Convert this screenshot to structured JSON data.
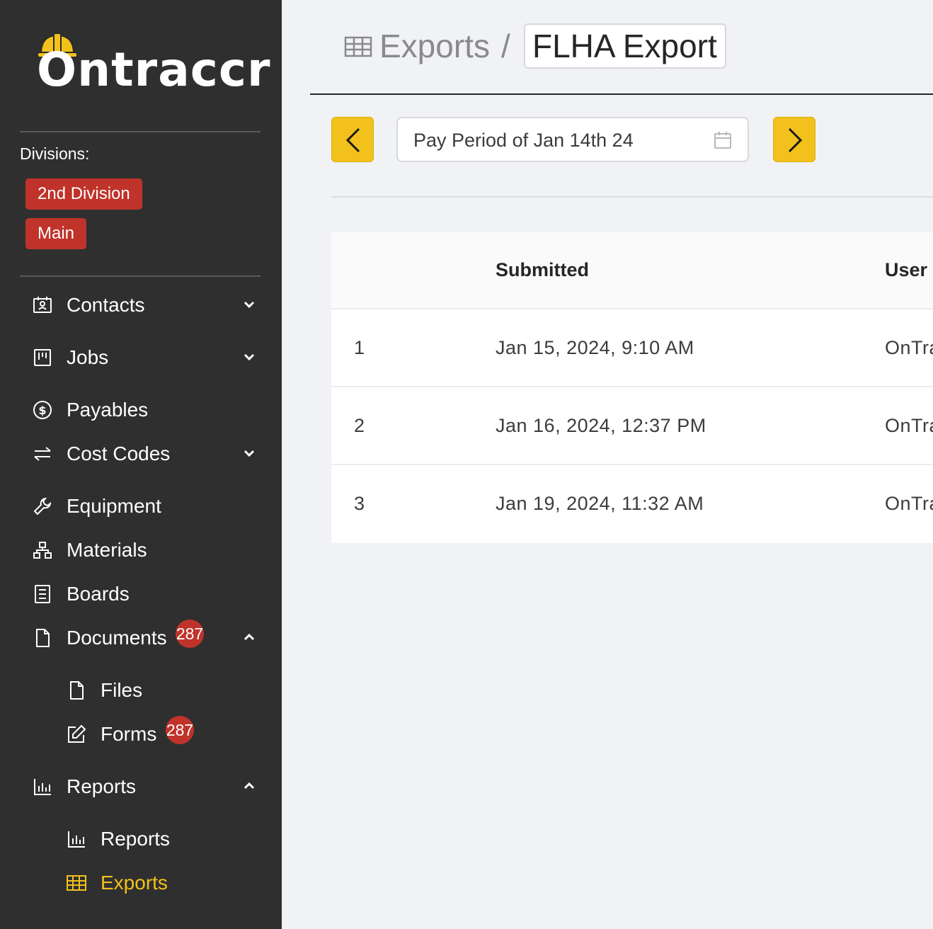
{
  "brand": {
    "name": "Ontraccr"
  },
  "sidebar": {
    "divisions_label": "Divisions:",
    "divisions": [
      "2nd Division",
      "Main"
    ],
    "items": [
      {
        "label": "Contacts",
        "icon": "contacts-card-icon",
        "chevron": "down"
      },
      {
        "label": "Jobs",
        "icon": "jobs-board-icon",
        "chevron": "down"
      },
      {
        "label": "Payables",
        "icon": "dollar-circle-icon"
      },
      {
        "label": "Cost Codes",
        "icon": "swap-arrows-icon",
        "chevron": "down"
      },
      {
        "label": "Equipment",
        "icon": "wrench-icon"
      },
      {
        "label": "Materials",
        "icon": "hierarchy-icon"
      },
      {
        "label": "Boards",
        "icon": "boards-icon"
      },
      {
        "label": "Documents",
        "icon": "document-icon",
        "chevron": "up",
        "badge": "287"
      },
      {
        "label": "Files",
        "icon": "file-icon",
        "sub": true
      },
      {
        "label": "Forms",
        "icon": "edit-form-icon",
        "sub": true,
        "badge": "287"
      },
      {
        "label": "Reports",
        "icon": "bar-chart-icon",
        "chevron": "up"
      },
      {
        "label": "Reports",
        "icon": "bar-chart-icon",
        "sub": true
      },
      {
        "label": "Exports",
        "icon": "table-grid-icon",
        "sub": true,
        "active": true
      }
    ]
  },
  "breadcrumb": {
    "parent": "Exports",
    "separator": "/",
    "current": "FLHA Export"
  },
  "period": {
    "label": "Pay Period of Jan 14th 24"
  },
  "table": {
    "columns": [
      "Submitted",
      "User"
    ],
    "rows": [
      {
        "index": "1",
        "submitted": "Jan 15, 2024, 9:10 AM",
        "user": "OnTra"
      },
      {
        "index": "2",
        "submitted": "Jan 16, 2024, 12:37 PM",
        "user": "OnTra"
      },
      {
        "index": "3",
        "submitted": "Jan 19, 2024, 11:32 AM",
        "user": "OnTra"
      }
    ]
  },
  "colors": {
    "sidebar_bg": "#2f2f2f",
    "accent": "#f2c11c",
    "badge": "#c0332a",
    "main_bg": "#f0f2f5"
  }
}
